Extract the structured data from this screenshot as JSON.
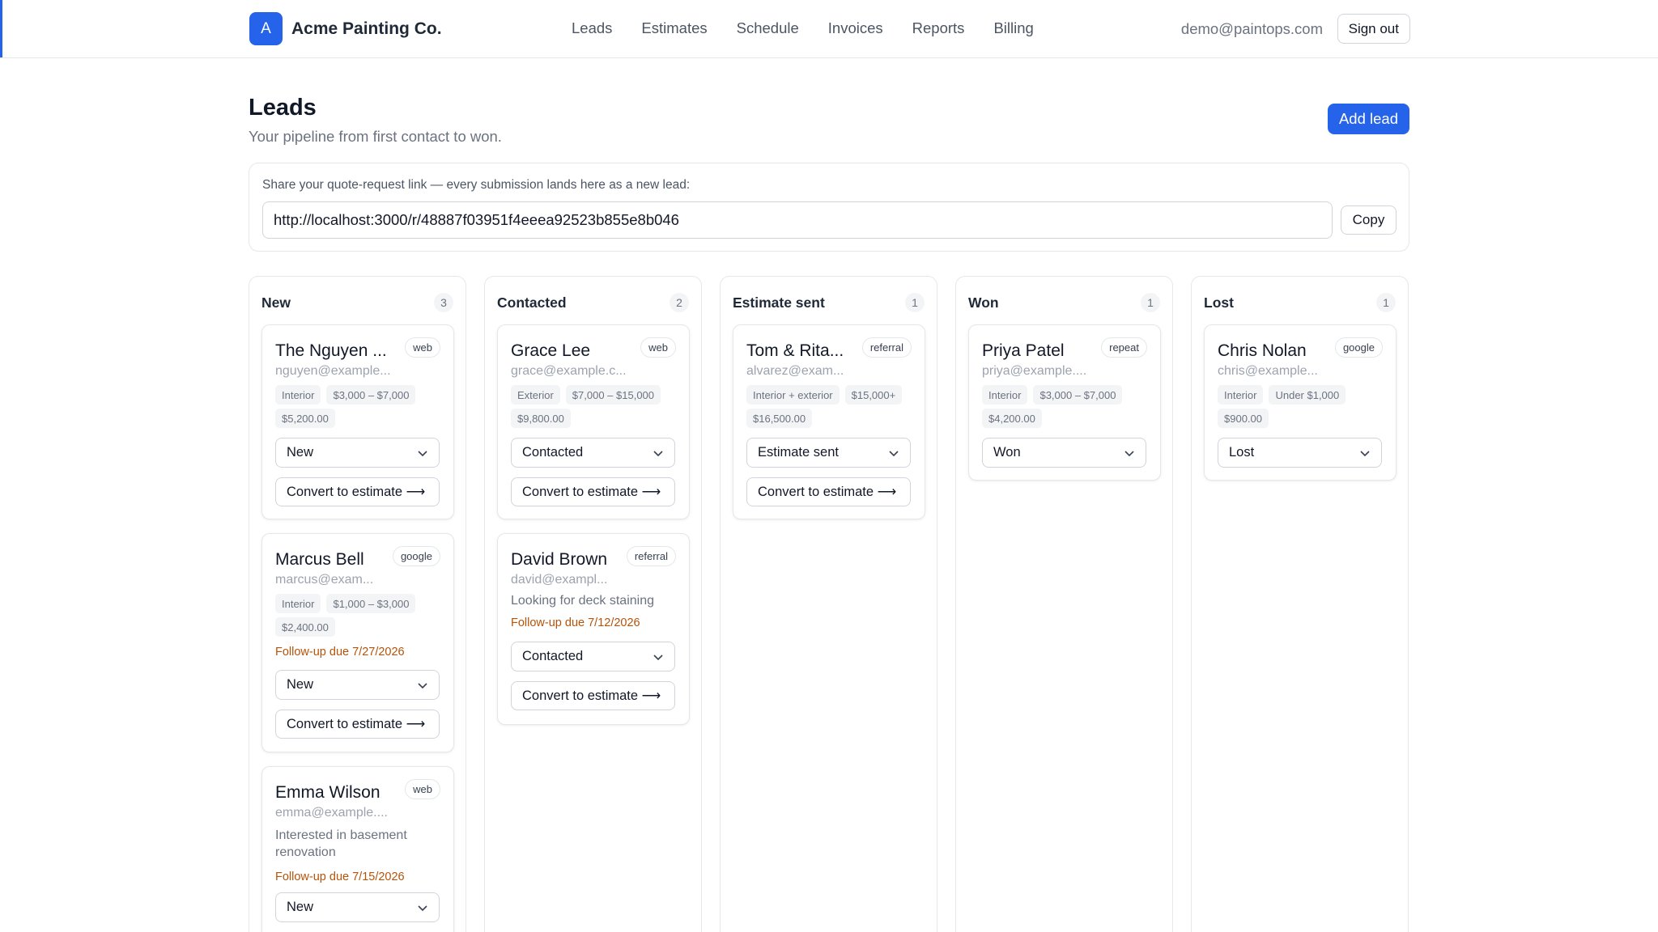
{
  "app": {
    "logo_letter": "A",
    "name": "Acme Painting Co.",
    "accent": "#2563eb"
  },
  "nav": [
    "Leads",
    "Estimates",
    "Schedule",
    "Invoices",
    "Reports",
    "Billing"
  ],
  "user": {
    "email": "demo@paintops.com",
    "sign_out": "Sign out"
  },
  "page": {
    "title": "Leads",
    "subtitle": "Your pipeline from first contact to won.",
    "add_button": "Add lead"
  },
  "share": {
    "label": "Share your quote-request link — every submission lands here as a new lead:",
    "url": "http://localhost:3000/r/48887f03951f4eeea92523b855e8b046",
    "copy": "Copy"
  },
  "convert_label": "Convert to estimate ⟶",
  "followup_color": "#b45309",
  "columns": [
    {
      "title": "New",
      "count": "3",
      "cards": [
        {
          "name": "The Nguyen ...",
          "source": "web",
          "email": "nguyen@example...",
          "tags": [
            "Interior",
            "$3,000 – $7,000"
          ],
          "amount": "$5,200.00",
          "status": "New"
        },
        {
          "name": "Marcus Bell",
          "source": "google",
          "email": "marcus@exam...",
          "tags": [
            "Interior",
            "$1,000 – $3,000"
          ],
          "amount": "$2,400.00",
          "followup": "Follow-up due 7/27/2026",
          "status": "New"
        },
        {
          "name": "Emma Wilson",
          "source": "web",
          "email": "emma@example....",
          "note": "Interested in basement renovation",
          "followup": "Follow-up due 7/15/2026",
          "status": "New"
        }
      ]
    },
    {
      "title": "Contacted",
      "count": "2",
      "cards": [
        {
          "name": "Grace Lee",
          "source": "web",
          "email": "grace@example.c...",
          "tags": [
            "Exterior",
            "$7,000 – $15,000"
          ],
          "amount": "$9,800.00",
          "status": "Contacted"
        },
        {
          "name": "David Brown",
          "source": "referral",
          "email": "david@exampl...",
          "note": "Looking for deck staining",
          "followup": "Follow-up due 7/12/2026",
          "status": "Contacted"
        }
      ]
    },
    {
      "title": "Estimate sent",
      "count": "1",
      "cards": [
        {
          "name": "Tom & Rita...",
          "source": "referral",
          "email": "alvarez@exam...",
          "tags": [
            "Interior + exterior",
            "$15,000+"
          ],
          "amount": "$16,500.00",
          "status": "Estimate sent"
        }
      ]
    },
    {
      "title": "Won",
      "count": "1",
      "cards": [
        {
          "name": "Priya Patel",
          "source": "repeat",
          "email": "priya@example....",
          "tags": [
            "Interior",
            "$3,000 – $7,000"
          ],
          "amount": "$4,200.00",
          "status": "Won"
        }
      ]
    },
    {
      "title": "Lost",
      "count": "1",
      "cards": [
        {
          "name": "Chris Nolan",
          "source": "google",
          "email": "chris@example...",
          "tags": [
            "Interior",
            "Under $1,000"
          ],
          "amount": "$900.00",
          "status": "Lost"
        }
      ]
    }
  ]
}
